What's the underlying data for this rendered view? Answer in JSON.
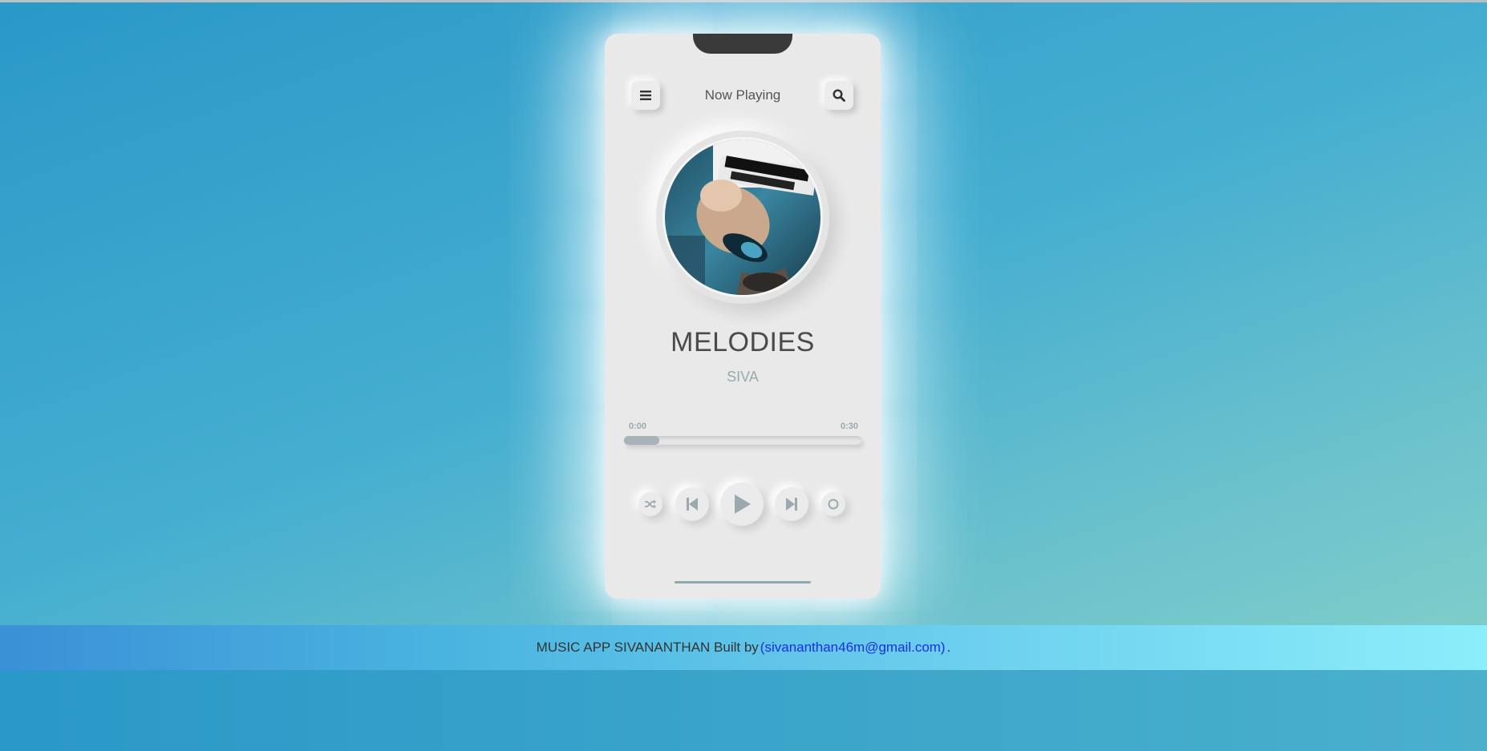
{
  "player": {
    "title": "Now Playing",
    "song": "MELODIES",
    "artist": "SIVA",
    "time_current": "0:00",
    "time_total": "0:30",
    "progress_fraction": 0.15,
    "icons": {
      "menu": "hamburger-menu-icon",
      "search": "search-icon",
      "shuffle": "shuffle-icon",
      "previous": "skip-previous-icon",
      "play": "play-icon",
      "next": "skip-next-icon",
      "repeat": "repeat-circle-icon"
    }
  },
  "footer": {
    "text": "MUSIC APP SIVANANTHAN Built by",
    "link": "(sivananthan46m@gmail.com)",
    "trailing": "."
  },
  "colors": {
    "card": "#e9e9e9",
    "control_icon": "#9aa9ad",
    "link": "#1a2fe0"
  }
}
